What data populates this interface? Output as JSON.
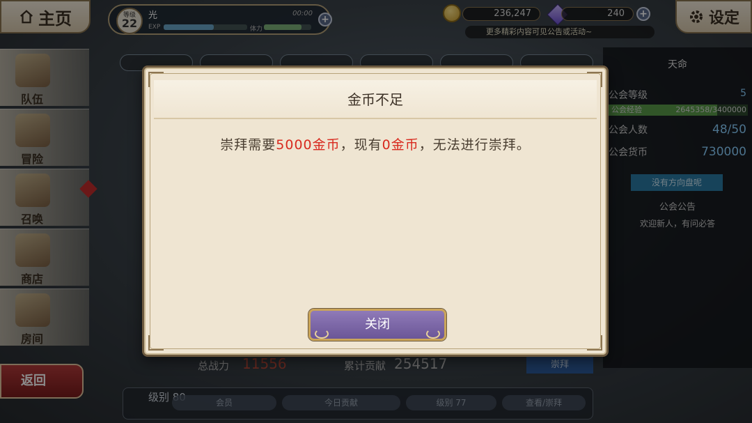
{
  "top_bar": {
    "home_label": "主页",
    "player": {
      "level_caption": "等级",
      "level": "22",
      "name": "光",
      "time": "00:00",
      "exp_label": "EXP",
      "stamina_label": "体力"
    },
    "gold": "236,247",
    "gems": "240",
    "news_text": "更多精彩内容可见公告或活动~",
    "settings_label": "设定"
  },
  "left_nav": {
    "items": [
      {
        "label": "队伍"
      },
      {
        "label": "冒险"
      },
      {
        "label": "召唤"
      },
      {
        "label": "商店"
      },
      {
        "label": "房间"
      }
    ],
    "back_label": "返回"
  },
  "guild_panel": {
    "title": "天命",
    "level_label": "公会等级",
    "level_value": "5",
    "exp_label": "公会经验",
    "exp_value": "2645358/3400000",
    "exp_fraction": 0.78,
    "members_label": "公会人数",
    "members_value": "48/50",
    "funds_label": "公会货币",
    "funds_value": "730000",
    "impeach_label": "没有方向盘呢",
    "notice_title": "公会公告",
    "notice_text": "欢迎新人，有问必答"
  },
  "list": {
    "power_label": "总战力",
    "power_value": "11556",
    "contrib_label": "累计贡献",
    "contrib_value": "254517",
    "worship_label": "崇拜",
    "member_level": "级别 80",
    "member_pills": [
      "会员",
      "今日贡献",
      "级别 77",
      "查看/崇拜"
    ]
  },
  "modal": {
    "title": "金币不足",
    "message_parts": [
      "崇拜需要",
      "5000金币",
      "，现有",
      "0金币",
      "，无法进行崇拜。"
    ],
    "close_label": "关闭"
  },
  "colors": {
    "modal_bg": "#efe5d2",
    "modal_border": "#6d5a3f",
    "highlight_red": "#d8291e",
    "close_button": "#7a64a6"
  }
}
